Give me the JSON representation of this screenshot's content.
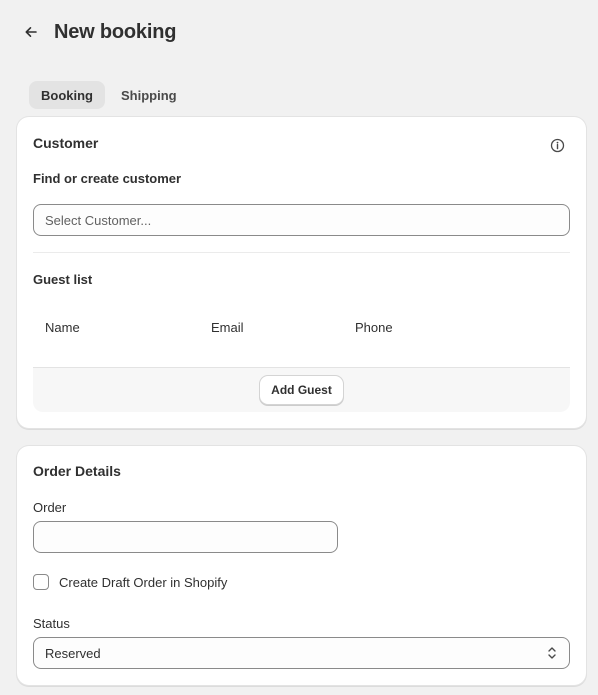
{
  "header": {
    "title": "New booking"
  },
  "tabs": [
    {
      "label": "Booking",
      "active": true
    },
    {
      "label": "Shipping",
      "active": false
    }
  ],
  "customer": {
    "title": "Customer",
    "find_label": "Find or create customer",
    "select_placeholder": "Select Customer...",
    "select_value": "",
    "guest_list": {
      "title": "Guest list",
      "columns": [
        "Name",
        "Email",
        "Phone"
      ],
      "rows": [],
      "add_button": "Add Guest"
    }
  },
  "order_details": {
    "title": "Order Details",
    "order_label": "Order",
    "order_value": "",
    "draft_checkbox_label": "Create Draft Order in Shopify",
    "draft_checked": false,
    "status_label": "Status",
    "status_value": "Reserved"
  },
  "icons": {
    "back": "arrow-left-icon",
    "info": "info-icon",
    "select": "chevron-up-down-icon"
  },
  "colors": {
    "background": "#f1f1f1",
    "card": "#ffffff",
    "text": "#303030",
    "border": "#8a8a8a",
    "active_tab": "#e3e3e3"
  }
}
